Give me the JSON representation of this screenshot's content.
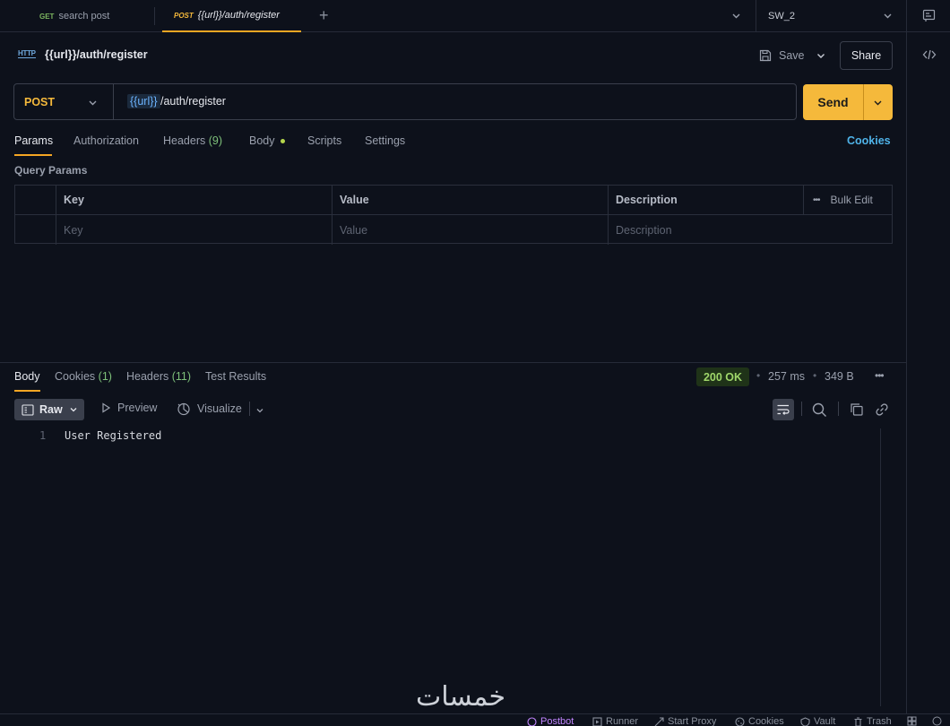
{
  "tabs": [
    {
      "method": "GET",
      "label": "search post"
    },
    {
      "method": "POST",
      "label": "{{url}}/auth/register"
    }
  ],
  "environment": {
    "name": "SW_2"
  },
  "request": {
    "title": "{{url}}/auth/register",
    "http_icon_label": "HTTP",
    "method": "POST",
    "url_variable": "{{url}}",
    "url_path": "/auth/register"
  },
  "toolbar": {
    "save_label": "Save",
    "share_label": "Share",
    "send_label": "Send"
  },
  "request_tabs": {
    "params": "Params",
    "authorization": "Authorization",
    "headers": "Headers",
    "headers_count": "(9)",
    "body": "Body",
    "scripts": "Scripts",
    "settings": "Settings",
    "cookies": "Cookies"
  },
  "query_params": {
    "label": "Query Params",
    "columns": [
      "Key",
      "Value",
      "Description"
    ],
    "bulk_edit": "Bulk Edit",
    "placeholders": [
      "Key",
      "Value",
      "Description"
    ]
  },
  "response": {
    "tabs": {
      "body": "Body",
      "cookies": "Cookies",
      "cookies_count": "(1)",
      "headers": "Headers",
      "headers_count": "(11)",
      "test_results": "Test Results"
    },
    "status": "200 OK",
    "time": "257 ms",
    "size": "349 B",
    "format": "Raw",
    "preview": "Preview",
    "visualize": "Visualize",
    "lines": [
      {
        "num": "1",
        "text": "User Registered"
      }
    ]
  },
  "footer": {
    "postbot": "Postbot",
    "runner": "Runner",
    "start_proxy": "Start Proxy",
    "cookies": "Cookies",
    "vault": "Vault",
    "trash": "Trash"
  },
  "watermark": "خمسات",
  "colors": {
    "accent": "#f5a623",
    "send": "#f5b93b",
    "status_ok": "#9fd66a",
    "link": "#4fb3e8"
  }
}
